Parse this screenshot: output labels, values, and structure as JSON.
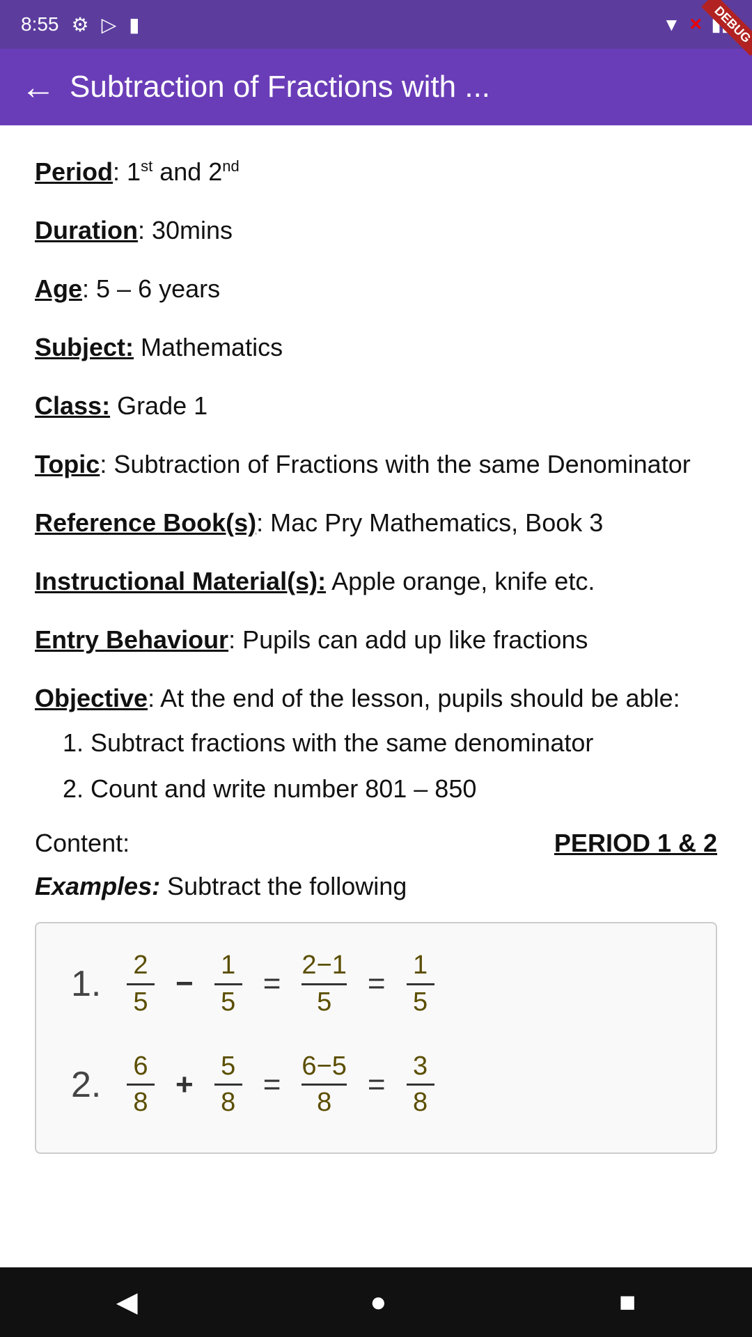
{
  "statusBar": {
    "time": "8:55",
    "wifiIcon": "wifi-icon",
    "batteryIcon": "battery-icon",
    "gearIcon": "gear-icon",
    "playIcon": "play-icon",
    "clipboardIcon": "clipboard-icon",
    "debugBadge": "DEBUG"
  },
  "appBar": {
    "backLabel": "←",
    "title": "Subtraction of Fractions with ..."
  },
  "content": {
    "periodLabel": "Period",
    "periodValue": ": 1",
    "periodSup1": "st",
    "periodAnd": " and 2",
    "periodSup2": "nd",
    "durationLabel": "Duration",
    "durationValue": ": 30mins",
    "ageLabel": "Age",
    "ageValue": ": 5 – 6 years",
    "subjectLabel": "Subject:",
    "subjectValue": " Mathematics",
    "classLabel": "Class:",
    "classValue": " Grade 1",
    "topicLabel": "Topic",
    "topicValue": ": Subtraction of Fractions with the same Denominator",
    "refBookLabel": "Reference Book(s)",
    "refBookValue": ": Mac Pry Mathematics, Book 3",
    "instrMaterialLabel": "Instructional Material(s):",
    "instrMaterialValue": " Apple orange, knife etc.",
    "entryBehaviourLabel": "Entry Behaviour",
    "entryBehaviourValue": ": Pupils can add up like fractions",
    "objectiveLabel": "Objective",
    "objectiveValue": ": At the end of the lesson, pupils should be able:",
    "objectives": [
      "Subtract fractions with the same denominator",
      "Count and write number 801 – 850"
    ],
    "contentLabel": "Content",
    "contentColon": ":",
    "periodHeader": "PERIOD 1 & 2",
    "examplesLabel": "Examples:",
    "examplesText": " Subtract the following",
    "examples": [
      {
        "num": "1.",
        "op": "−",
        "n1": "2",
        "d1": "5",
        "n2": "1",
        "d2": "5",
        "n3": "2−1",
        "d3": "5",
        "n4": "1",
        "d4": "5"
      },
      {
        "num": "2.",
        "op": "+",
        "n1": "6",
        "d1": "8",
        "n2": "5",
        "d2": "8",
        "n3": "6−5",
        "d3": "8",
        "n4": "3",
        "d4": "8"
      }
    ]
  },
  "navBar": {
    "backBtn": "◀",
    "homeBtn": "●",
    "recentBtn": "■"
  }
}
